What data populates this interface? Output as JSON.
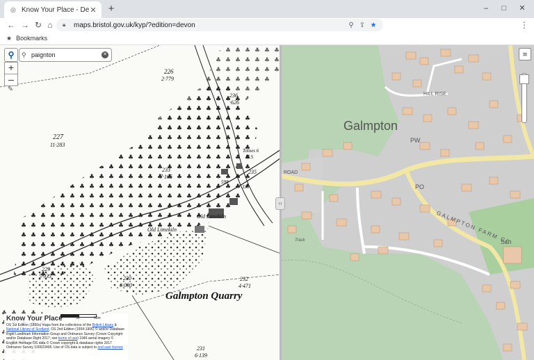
{
  "tab": {
    "title": "Know Your Place - Devon",
    "favicon": "globe-icon"
  },
  "window": {
    "minimize": "–",
    "maximize": "□",
    "close": "✕"
  },
  "toolbar": {
    "url": "maps.bristol.gov.uk/kyp/?edition=devon"
  },
  "bookmarks": {
    "label": "Bookmarks"
  },
  "map_controls": {
    "search_value": "paignton",
    "zoom_in": "+",
    "zoom_out": "–"
  },
  "historic_map": {
    "labels": [
      {
        "text": "226",
        "name": "parcel-226"
      },
      {
        "text": "2·779",
        "name": "parcel-226-area"
      },
      {
        "text": "236",
        "name": "parcel-236"
      },
      {
        "text": "·626",
        "name": "parcel-236-area"
      },
      {
        "text": "227",
        "name": "parcel-227"
      },
      {
        "text": "11·283",
        "name": "parcel-227-area"
      },
      {
        "text": "233",
        "name": "parcel-233"
      },
      {
        "text": "7·105",
        "name": "parcel-233-area"
      },
      {
        "text": "235",
        "name": "parcel-235"
      },
      {
        "text": "598",
        "name": "parcel-598"
      },
      {
        "text": "339",
        "name": "parcel-339"
      },
      {
        "text": "Totnes 6",
        "name": "milestone-totnes"
      },
      {
        "text": "M.S",
        "name": "milestone-ms"
      },
      {
        "text": "Old Limekiln",
        "name": "old-limekiln-1"
      },
      {
        "text": "Old Limekiln",
        "name": "old-limekiln-2"
      },
      {
        "text": "229",
        "name": "parcel-229"
      },
      {
        "text": "5·933",
        "name": "parcel-229-area"
      },
      {
        "text": "230",
        "name": "parcel-230"
      },
      {
        "text": "6·030",
        "name": "parcel-230-area"
      },
      {
        "text": "232",
        "name": "parcel-232"
      },
      {
        "text": "4·471",
        "name": "parcel-232-area"
      },
      {
        "text": "Galmpton  Quarry",
        "name": "galmpton-quarry"
      },
      {
        "text": "231",
        "name": "parcel-231"
      },
      {
        "text": "6·139",
        "name": "parcel-231-area"
      }
    ]
  },
  "modern_map": {
    "labels": [
      {
        "text": "Galmpton",
        "name": "place-galmpton"
      },
      {
        "text": "HILL RISE",
        "name": "street-hill-rise"
      },
      {
        "text": "PW",
        "name": "label-pw"
      },
      {
        "text": "PO",
        "name": "label-po"
      },
      {
        "text": "Sch",
        "name": "label-sch"
      },
      {
        "text": "GALMPTON FARM CL",
        "name": "street-galmpton-farm-cl"
      },
      {
        "text": "ROAD",
        "name": "street-road"
      },
      {
        "text": "Track",
        "name": "label-track"
      }
    ]
  },
  "infobox": {
    "title": "Know Your Place",
    "line1_pre": "OS 1st Edition (1860s) maps from the collections of the ",
    "line1_link": "British Library",
    "line1_mid": " & ",
    "line1_link2": "National Library of Scotland",
    "line1_post": ", OS 2nd Edition (1904-1906) © and/or Database Right Landmark Information Group and Ordnance Survey (Crown Copyright and/or Database Right 2017; see ",
    "line2_link": "terms of use",
    "line2_post": ") 1946 aerial imagery © English Heritage OS data © Crown copyright & database rights 2017 Ordnance Survey 100023406. Use of OS data is subject to ",
    "line3_link": "end user licence"
  },
  "scale": {
    "labels": [
      "0",
      "30",
      "60m"
    ]
  }
}
